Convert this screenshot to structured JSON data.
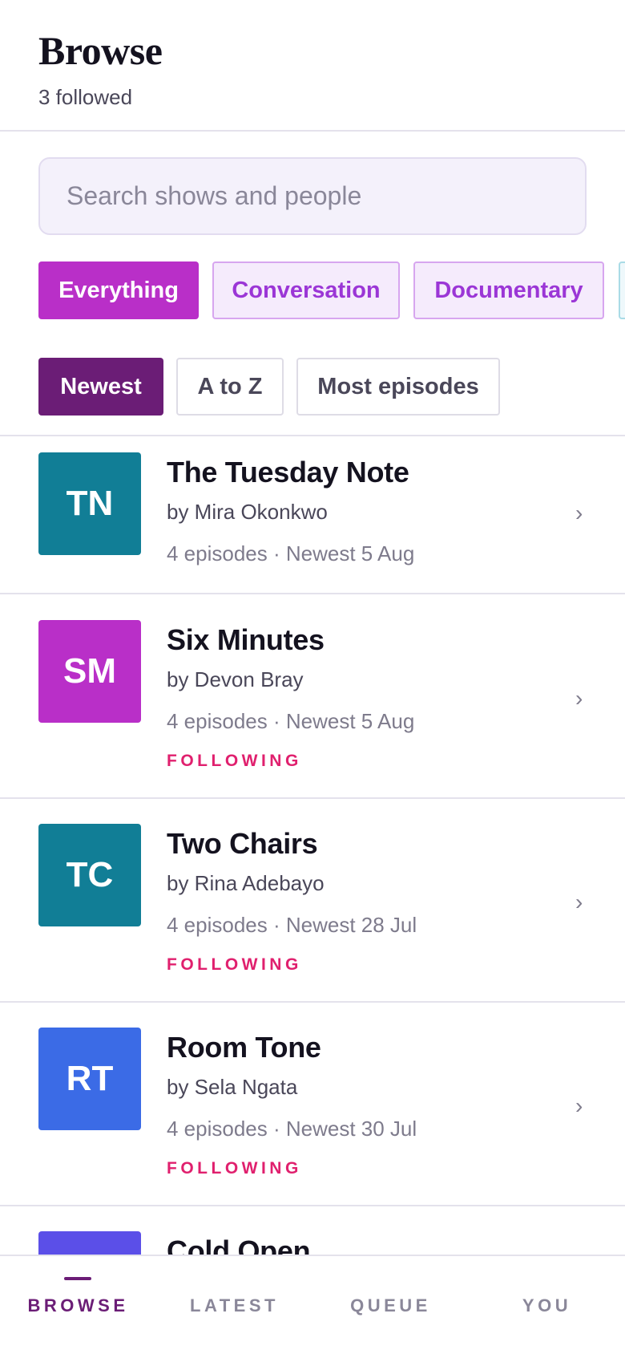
{
  "header": {
    "title": "Browse",
    "followed_count": "3 followed"
  },
  "search": {
    "placeholder": "Search shows and people"
  },
  "categories": [
    {
      "label": "Everything",
      "active": true
    },
    {
      "label": "Conversation",
      "active": false
    },
    {
      "label": "Documentary",
      "active": false
    }
  ],
  "sort_options": [
    {
      "label": "Newest",
      "active": true
    },
    {
      "label": "A to Z",
      "active": false
    },
    {
      "label": "Most episodes",
      "active": false
    }
  ],
  "shows": [
    {
      "initials": "TN",
      "title": "The Tuesday Note",
      "author": "by Mira Okonkwo",
      "meta": "4 episodes · Newest 5 Aug",
      "following": "",
      "color": "#117e96"
    },
    {
      "initials": "SM",
      "title": "Six Minutes",
      "author": "by Devon Bray",
      "meta": "4 episodes · Newest 5 Aug",
      "following": "FOLLOWING",
      "color": "#b92fc8"
    },
    {
      "initials": "TC",
      "title": "Two Chairs",
      "author": "by Rina Adebayo",
      "meta": "4 episodes · Newest 28 Jul",
      "following": "FOLLOWING",
      "color": "#117e96"
    },
    {
      "initials": "RT",
      "title": "Room Tone",
      "author": "by Sela Ngata",
      "meta": "4 episodes · Newest 30 Jul",
      "following": "FOLLOWING",
      "color": "#3b6be6"
    },
    {
      "initials": "",
      "title": "Cold Open",
      "author": "",
      "meta": "",
      "following": "",
      "color": "#5b4fe8"
    }
  ],
  "chevron_glyph": "›",
  "tabs": [
    {
      "label": "BROWSE",
      "active": true
    },
    {
      "label": "LATEST",
      "active": false
    },
    {
      "label": "QUEUE",
      "active": false
    },
    {
      "label": "YOU",
      "active": false
    }
  ],
  "colors": {
    "accent": "#b92fc8",
    "accent_dark": "#6b1d76",
    "following": "#e0206e"
  }
}
